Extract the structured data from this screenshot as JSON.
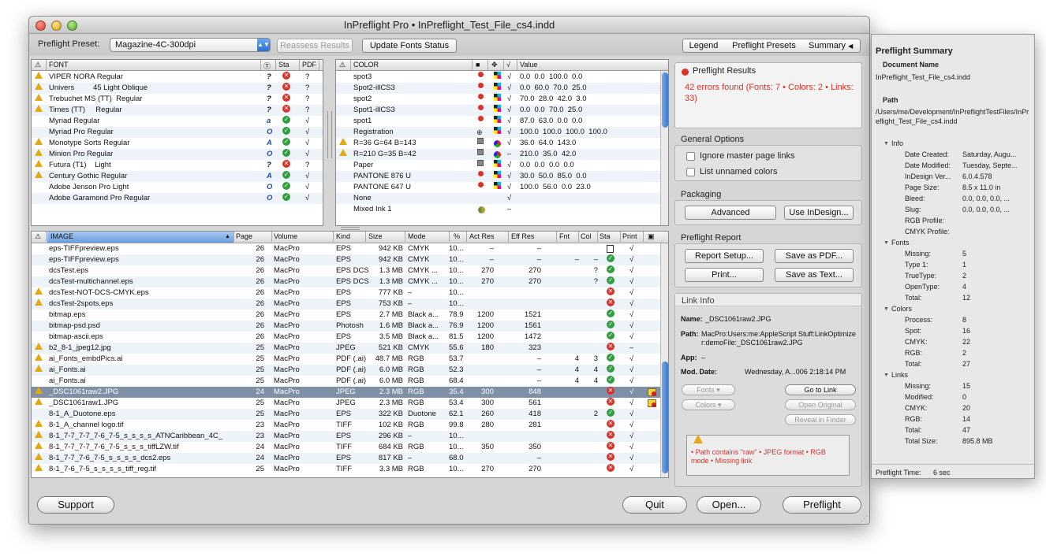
{
  "window": {
    "title": "InPreflight Pro • InPreflight_Test_File_cs4.indd"
  },
  "toolbar": {
    "preset_label": "Preflight Preset:",
    "preset_value": "Magazine-4C-300dpi",
    "reassess": "Reassess Results",
    "update_fonts": "Update Fonts Status",
    "tabs": [
      "Legend",
      "Preflight Presets",
      "Summary"
    ]
  },
  "fonts": {
    "headers": {
      "font": "FONT",
      "sta": "Sta",
      "pdf": "PDF"
    },
    "rows": [
      {
        "warn": true,
        "name": "VIPER NORA Regular",
        "type": "?",
        "sta": "err",
        "pdf": "?"
      },
      {
        "warn": true,
        "name": "Univers         45 Light Oblique",
        "type": "?",
        "sta": "err",
        "pdf": "?"
      },
      {
        "warn": true,
        "name": "Trebuchet MS (TT)  Regular",
        "type": "?",
        "sta": "err",
        "pdf": "?"
      },
      {
        "warn": true,
        "name": "Times (TT)     Regular",
        "type": "?",
        "sta": "err",
        "pdf": "?"
      },
      {
        "warn": false,
        "name": "Myriad Regular",
        "type": "a",
        "sta": "ok",
        "pdf": "√"
      },
      {
        "warn": false,
        "name": "Myriad Pro Regular",
        "type": "O",
        "sta": "ok",
        "pdf": "√"
      },
      {
        "warn": true,
        "name": "Monotype Sorts Regular",
        "type": "A",
        "sta": "ok",
        "pdf": "√"
      },
      {
        "warn": true,
        "name": "Minion Pro Regular",
        "type": "O",
        "sta": "ok",
        "pdf": "√"
      },
      {
        "warn": true,
        "name": "Futura (T1)    Light",
        "type": "?",
        "sta": "err",
        "pdf": "?"
      },
      {
        "warn": true,
        "name": "Century Gothic Regular",
        "type": "A",
        "sta": "ok",
        "pdf": "√"
      },
      {
        "warn": false,
        "name": "Adobe Jenson Pro Light",
        "type": "O",
        "sta": "ok",
        "pdf": "√"
      },
      {
        "warn": false,
        "name": "Adobe Garamond Pro Regular",
        "type": "O",
        "sta": "ok",
        "pdf": "√"
      }
    ]
  },
  "colors": {
    "headers": {
      "color": "COLOR",
      "value": "Value"
    },
    "rows": [
      {
        "warn": false,
        "name": "spot3",
        "kind": "dot",
        "sw": "cmyk",
        "chk": "√",
        "value": "0.0  0.0  100.0  0.0"
      },
      {
        "warn": false,
        "name": "Spot2-illCS3",
        "kind": "dot",
        "sw": "cmyk",
        "chk": "√",
        "value": "0.0  60.0  70.0  25.0"
      },
      {
        "warn": false,
        "name": "spot2",
        "kind": "dot",
        "sw": "cmyk",
        "chk": "√",
        "value": "70.0  28.0  42.0  3.0"
      },
      {
        "warn": false,
        "name": "Spot1-illCS3",
        "kind": "dot",
        "sw": "cmyk",
        "chk": "√",
        "value": "0.0  0.0  70.0  25.0"
      },
      {
        "warn": false,
        "name": "spot1",
        "kind": "dot",
        "sw": "cmyk",
        "chk": "√",
        "value": "87.0  63.0  0.0  0.0"
      },
      {
        "warn": false,
        "name": "Registration",
        "kind": "reg",
        "sw": "cmyk",
        "chk": "√",
        "value": "100.0  100.0  100.0  100.0"
      },
      {
        "warn": true,
        "name": "R=36 G=64 B=143",
        "kind": "grid",
        "sw": "rgb",
        "chk": "√",
        "value": "36.0  64.0  143.0"
      },
      {
        "warn": true,
        "name": "R=210 G=35 B=42",
        "kind": "grid",
        "sw": "rgb",
        "chk": "–",
        "value": "210.0  35.0  42.0"
      },
      {
        "warn": false,
        "name": "Paper",
        "kind": "grid",
        "sw": "cmyk",
        "chk": "√",
        "value": "0.0  0.0  0.0  0.0"
      },
      {
        "warn": false,
        "name": "PANTONE 876 U",
        "kind": "dot",
        "sw": "cmyk",
        "chk": "√",
        "value": "30.0  50.0  85.0  0.0"
      },
      {
        "warn": false,
        "name": "PANTONE 647 U",
        "kind": "dot",
        "sw": "cmyk",
        "chk": "√",
        "value": "100.0  56.0  0.0  23.0"
      },
      {
        "warn": false,
        "name": "None",
        "kind": "",
        "sw": "",
        "chk": "√",
        "value": ""
      },
      {
        "warn": false,
        "name": "Mixed Ink 1",
        "kind": "",
        "sw": "mix",
        "chk": "–",
        "value": ""
      }
    ]
  },
  "images": {
    "headers": [
      "IMAGE",
      "Page",
      "Volume",
      "Kind",
      "Size",
      "Mode",
      "%",
      "Act Res",
      "Eff Res",
      "Fnt",
      "Col",
      "Sta",
      "Print"
    ],
    "rows": [
      {
        "w": false,
        "name": "eps-TIFFpreview.eps",
        "page": "26",
        "vol": "MacPro",
        "kind": "EPS",
        "size": "942 KB",
        "mode": "CMYK",
        "pct": "10...",
        "act": "–",
        "eff": "–",
        "fnt": "",
        "col": "",
        "sta": "doc",
        "print": "√"
      },
      {
        "w": false,
        "name": "eps-TIFFpreview.eps",
        "page": "26",
        "vol": "MacPro",
        "kind": "EPS",
        "size": "942 KB",
        "mode": "CMYK",
        "pct": "10...",
        "act": "–",
        "eff": "–",
        "fnt": "–",
        "col": "–",
        "sta": "ok",
        "print": "√"
      },
      {
        "w": false,
        "name": "dcsTest.eps",
        "page": "26",
        "vol": "MacPro",
        "kind": "EPS DCS",
        "size": "1.3 MB",
        "mode": "CMYK ...",
        "pct": "10...",
        "act": "270",
        "eff": "270",
        "fnt": "",
        "col": "?",
        "sta": "ok",
        "print": "√"
      },
      {
        "w": false,
        "name": "dcsTest-multichannel.eps",
        "page": "26",
        "vol": "MacPro",
        "kind": "EPS DCS",
        "size": "1.3 MB",
        "mode": "CMYK ...",
        "pct": "10...",
        "act": "270",
        "eff": "270",
        "fnt": "",
        "col": "?",
        "sta": "ok",
        "print": "√"
      },
      {
        "w": true,
        "name": "dcsTest-NOT-DCS-CMYK.eps",
        "page": "26",
        "vol": "MacPro",
        "kind": "EPS",
        "size": "777 KB",
        "mode": "–",
        "pct": "10...",
        "act": "",
        "eff": "",
        "fnt": "",
        "col": "",
        "sta": "err",
        "print": "√"
      },
      {
        "w": true,
        "name": "dcsTest-2spots.eps",
        "page": "26",
        "vol": "MacPro",
        "kind": "EPS",
        "size": "753 KB",
        "mode": "–",
        "pct": "10...",
        "act": "",
        "eff": "",
        "fnt": "",
        "col": "",
        "sta": "err",
        "print": "√"
      },
      {
        "w": false,
        "name": "bitmap.eps",
        "page": "26",
        "vol": "MacPro",
        "kind": "EPS",
        "size": "2.7 MB",
        "mode": "Black a...",
        "pct": "78.9",
        "act": "1200",
        "eff": "1521",
        "fnt": "",
        "col": "",
        "sta": "ok",
        "print": "√"
      },
      {
        "w": false,
        "name": "bitmap-psd.psd",
        "page": "26",
        "vol": "MacPro",
        "kind": "Photosh",
        "size": "1.6 MB",
        "mode": "Black a...",
        "pct": "76.9",
        "act": "1200",
        "eff": "1561",
        "fnt": "",
        "col": "",
        "sta": "ok",
        "print": "√"
      },
      {
        "w": false,
        "name": "bitmap-ascii.eps",
        "page": "26",
        "vol": "MacPro",
        "kind": "EPS",
        "size": "3.5 MB",
        "mode": "Black a...",
        "pct": "81.5",
        "act": "1200",
        "eff": "1472",
        "fnt": "",
        "col": "",
        "sta": "ok",
        "print": "√"
      },
      {
        "w": true,
        "name": "b2_8-1_jpeg12.jpg",
        "page": "25",
        "vol": "MacPro",
        "kind": "JPEG",
        "size": "521 KB",
        "mode": "CMYK",
        "pct": "55.6",
        "act": "180",
        "eff": "323",
        "fnt": "",
        "col": "",
        "sta": "err",
        "print": "–"
      },
      {
        "w": true,
        "name": "ai_Fonts_embdPics.ai",
        "page": "25",
        "vol": "MacPro",
        "kind": "PDF (.ai)",
        "size": "48.7 MB",
        "mode": "RGB",
        "pct": "53.7",
        "act": "",
        "eff": "–",
        "fnt": "4",
        "col": "3",
        "sta": "ok",
        "print": "√"
      },
      {
        "w": true,
        "name": "ai_Fonts.ai",
        "page": "25",
        "vol": "MacPro",
        "kind": "PDF (.ai)",
        "size": "6.0 MB",
        "mode": "RGB",
        "pct": "52.3",
        "act": "",
        "eff": "–",
        "fnt": "4",
        "col": "4",
        "sta": "ok",
        "print": "√"
      },
      {
        "w": false,
        "name": "ai_Fonts.ai",
        "page": "25",
        "vol": "MacPro",
        "kind": "PDF (.ai)",
        "size": "6.0 MB",
        "mode": "RGB",
        "pct": "68.4",
        "act": "",
        "eff": "–",
        "fnt": "4",
        "col": "4",
        "sta": "ok",
        "print": "√"
      },
      {
        "w": true,
        "name": "_DSC1061raw2.JPG",
        "page": "24",
        "vol": "MacPro",
        "kind": "JPEG",
        "size": "2.3 MB",
        "mode": "RGB",
        "pct": "35.4",
        "act": "300",
        "eff": "848",
        "fnt": "",
        "col": "",
        "sta": "err",
        "print": "√",
        "sel": true,
        "lock": true
      },
      {
        "w": true,
        "name": "_DSC1061raw1.JPG",
        "page": "25",
        "vol": "MacPro",
        "kind": "JPEG",
        "size": "2.3 MB",
        "mode": "RGB",
        "pct": "53.4",
        "act": "300",
        "eff": "561",
        "fnt": "",
        "col": "",
        "sta": "err",
        "print": "√",
        "lock": true
      },
      {
        "w": false,
        "name": "8-1_A_Duotone.eps",
        "page": "25",
        "vol": "MacPro",
        "kind": "EPS",
        "size": "322 KB",
        "mode": "Duotone",
        "pct": "62.1",
        "act": "260",
        "eff": "418",
        "fnt": "",
        "col": "2",
        "sta": "ok",
        "print": "√"
      },
      {
        "w": true,
        "name": "8-1_A_channel logo.tif",
        "page": "23",
        "vol": "MacPro",
        "kind": "TIFF",
        "size": "102 KB",
        "mode": "RGB",
        "pct": "99.8",
        "act": "280",
        "eff": "281",
        "fnt": "",
        "col": "",
        "sta": "err",
        "print": "√"
      },
      {
        "w": true,
        "name": "8-1_7-7_7-7_7-6_7-5_s_s_s_s_ATNCaribbean_4C_",
        "page": "23",
        "vol": "MacPro",
        "kind": "EPS",
        "size": "296 KB",
        "mode": "–",
        "pct": "10...",
        "act": "",
        "eff": "",
        "fnt": "",
        "col": "",
        "sta": "err",
        "print": "√"
      },
      {
        "w": true,
        "name": "8-1_7-7_7-7_7-6_7-5_s_s_s_tiffLZW.tif",
        "page": "24",
        "vol": "MacPro",
        "kind": "TIFF",
        "size": "684 KB",
        "mode": "RGB",
        "pct": "10...",
        "act": "350",
        "eff": "350",
        "fnt": "",
        "col": "",
        "sta": "err",
        "print": "√"
      },
      {
        "w": true,
        "name": "8-1_7-7_7-6_7-5_s_s_s_s_dcs2.eps",
        "page": "24",
        "vol": "MacPro",
        "kind": "EPS",
        "size": "817 KB",
        "mode": "–",
        "pct": "68.0",
        "act": "",
        "eff": "–",
        "fnt": "",
        "col": "",
        "sta": "err",
        "print": "√"
      },
      {
        "w": true,
        "name": "8-1_7-6_7-5_s_s_s_s_tiff_reg.tif",
        "page": "25",
        "vol": "MacPro",
        "kind": "TIFF",
        "size": "3.3 MB",
        "mode": "RGB",
        "pct": "10...",
        "act": "270",
        "eff": "270",
        "fnt": "",
        "col": "",
        "sta": "err",
        "print": "√"
      }
    ]
  },
  "results": {
    "title": "Preflight Results",
    "text": "42 errors found (Fonts: 7 • Colors: 2 • Links: 33)"
  },
  "general": {
    "title": "General Options",
    "ignore": "Ignore master page links",
    "unnamed": "List unnamed colors"
  },
  "packaging": {
    "title": "Packaging",
    "advanced": "Advanced",
    "indesign": "Use InDesign..."
  },
  "report": {
    "title": "Preflight Report",
    "setup": "Report Setup...",
    "pdf": "Save as PDF...",
    "print": "Print...",
    "text": "Save as Text..."
  },
  "link": {
    "title": "Link Info",
    "name_lbl": "Name:",
    "name": "_DSC1061raw2.JPG",
    "path_lbl": "Path:",
    "path": "MacPro:Users:me:AppleScript Stuff:LinkOptimizer:demoFile:_DSC1061raw2.JPG",
    "app_lbl": "App:",
    "app": "–",
    "mod_lbl": "Mod. Date:",
    "mod": "Wednesday, A...006 2:18:14 PM",
    "fonts": "Fonts",
    "colors": "Colors",
    "goto": "Go to Link",
    "open_orig": "Open Original",
    "reveal": "Reveal in Finder",
    "issues": "• Path contains \"raw\" • JPEG format • RGB mode • Missing link"
  },
  "bottom": {
    "support": "Support",
    "quit": "Quit",
    "open": "Open...",
    "preflight": "Preflight"
  },
  "summary": {
    "title": "Preflight Summary",
    "docname_lbl": "Document Name",
    "docname": "InPreflight_Test_File_cs4.indd",
    "path_lbl": "Path",
    "path": "/Users/me/Development/InPreflightTestFiles/InPreflight_Test_File_cs4.indd",
    "info_lbl": "Info",
    "info": [
      [
        "Date Created:",
        "Saturday, Augu..."
      ],
      [
        "Date Modified:",
        "Tuesday, Septe..."
      ],
      [
        "InDesign Ver...",
        "6.0.4.578"
      ],
      [
        "Page Size:",
        "8.5 x 11.0 in"
      ],
      [
        "Bleed:",
        "0.0, 0.0, 0.0, ..."
      ],
      [
        "Slug:",
        "0.0, 0.0, 0.0, ..."
      ],
      [
        "RGB Profile:",
        ""
      ],
      [
        "CMYK Profile:",
        ""
      ]
    ],
    "fonts_lbl": "Fonts",
    "fonts": [
      [
        "Missing:",
        "5"
      ],
      [
        "Type 1:",
        "1"
      ],
      [
        "TrueType:",
        "2"
      ],
      [
        "OpenType:",
        "4"
      ],
      [
        "Total:",
        "12"
      ]
    ],
    "colors_lbl": "Colors",
    "colors": [
      [
        "Process:",
        "8"
      ],
      [
        "Spot:",
        "16"
      ],
      [
        "CMYK:",
        "22"
      ],
      [
        "RGB:",
        "2"
      ],
      [
        "Total:",
        "27"
      ]
    ],
    "links_lbl": "Links",
    "links": [
      [
        "Missing:",
        "15"
      ],
      [
        "Modified:",
        "0"
      ],
      [
        "CMYK:",
        "20"
      ],
      [
        "RGB:",
        "14"
      ],
      [
        "Total:",
        "47"
      ],
      [
        "Total Size:",
        "895.8 MB"
      ]
    ],
    "time_lbl": "Preflight Time:",
    "time": "6 sec"
  }
}
